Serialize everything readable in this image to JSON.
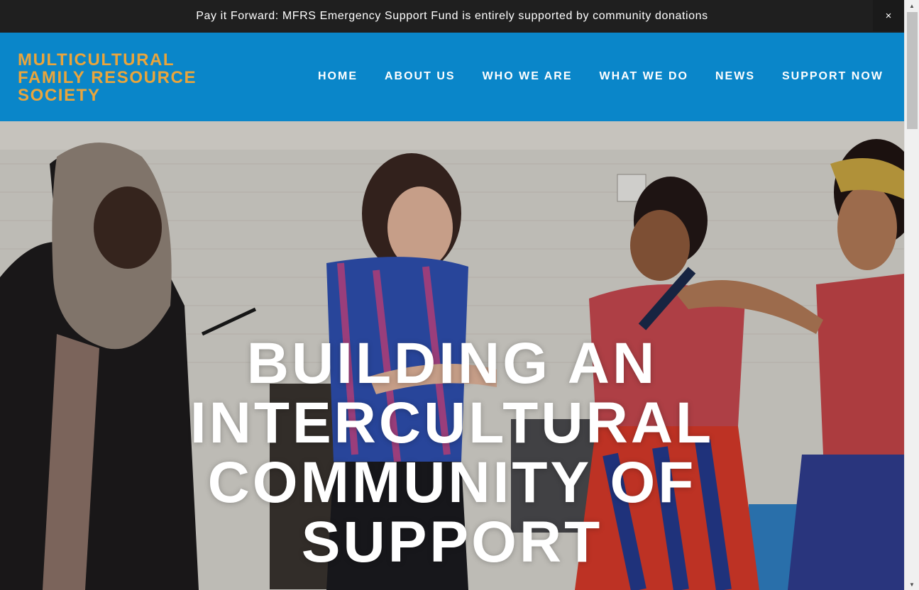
{
  "announcement": {
    "text": "Pay it Forward: MFRS Emergency Support Fund is entirely supported by community donations",
    "close_glyph": "×",
    "close_icon": "close-icon"
  },
  "header": {
    "logo_lines": [
      "MULTICULTURAL",
      "FAMILY RESOURCE",
      "SOCIETY"
    ],
    "nav": [
      "HOME",
      "ABOUT US",
      "WHO WE ARE",
      "WHAT WE DO",
      "NEWS",
      "SUPPORT NOW"
    ]
  },
  "hero": {
    "title_lines": [
      "BUILDING AN",
      "INTERCULTURAL",
      "COMMUNITY OF",
      "SUPPORT"
    ]
  },
  "scrollbar": {
    "up_glyph": "▲",
    "down_glyph": "▼"
  },
  "colors": {
    "announce_bg": "#1f1f1f",
    "header_bg": "#0a86c9",
    "logo": "#e9a53c",
    "nav_text": "#ffffff",
    "hero_text": "#ffffff"
  }
}
